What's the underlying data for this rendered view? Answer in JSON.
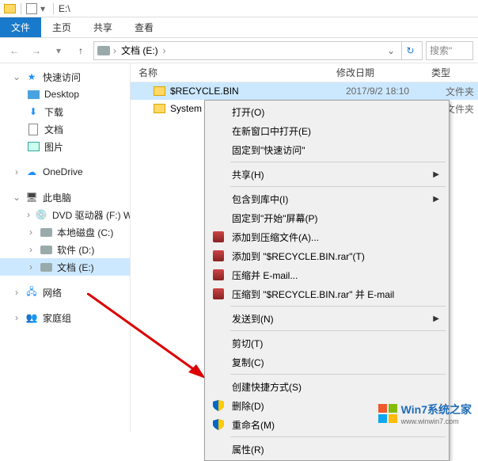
{
  "window": {
    "title": "E:\\"
  },
  "ribbon": {
    "file": "文件",
    "home": "主页",
    "share": "共享",
    "view": "查看"
  },
  "address": {
    "crumb1": "文档 (E:)",
    "sep": "›",
    "search_placeholder": "搜索\""
  },
  "columns": {
    "name": "名称",
    "date": "修改日期",
    "type": "类型"
  },
  "sidebar": {
    "quick": "快速访问",
    "desktop": "Desktop",
    "downloads": "下载",
    "documents": "文档",
    "pictures": "图片",
    "onedrive": "OneDrive",
    "thispc": "此电脑",
    "dvd": "DVD 驱动器 (F:) WIN",
    "localc": "本地磁盘 (C:)",
    "softd": "软件 (D:)",
    "doce": "文档 (E:)",
    "network": "网络",
    "homegroup": "家庭组"
  },
  "files": {
    "row1": {
      "name": "$RECYCLE.BIN",
      "date": "2017/9/2 18:10",
      "type": "文件夹"
    },
    "row2": {
      "name": "System V",
      "date": "",
      "type": "文件夹"
    }
  },
  "context": {
    "open": "打开(O)",
    "newwin": "在新窗口中打开(E)",
    "pin": "固定到\"快速访问\"",
    "share": "共享(H)",
    "include": "包含到库中(I)",
    "pinstart": "固定到\"开始\"屏幕(P)",
    "addarchive": "添加到压缩文件(A)...",
    "addrar": "添加到 \"$RECYCLE.BIN.rar\"(T)",
    "email": "压缩并 E-mail...",
    "raremail": "压缩到 \"$RECYCLE.BIN.rar\" 并 E-mail",
    "sendto": "发送到(N)",
    "cut": "剪切(T)",
    "copy": "复制(C)",
    "shortcut": "创建快捷方式(S)",
    "delete": "删除(D)",
    "rename": "重命名(M)",
    "props": "属性(R)"
  },
  "watermark": {
    "text": "Win7系统之家",
    "sub": "www.winwin7.com"
  }
}
